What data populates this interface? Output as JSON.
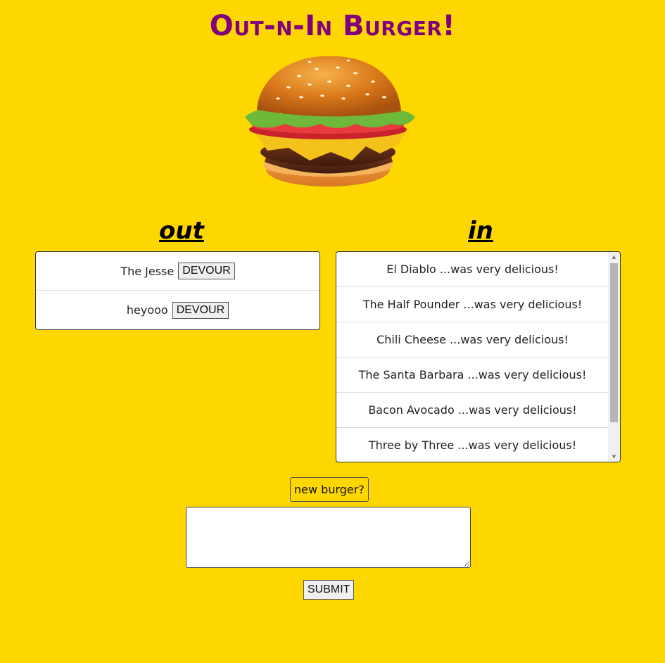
{
  "header": {
    "title": "Out-n-In Burger!"
  },
  "hero": {
    "image": "burger-illustration"
  },
  "out_column": {
    "heading": "out",
    "items": [
      {
        "name": "The Jesse",
        "button_label": "DEVOUR"
      },
      {
        "name": "heyooo",
        "button_label": "DEVOUR"
      }
    ]
  },
  "in_column": {
    "heading": "in",
    "items": [
      {
        "text": "El Diablo ...was very delicious!"
      },
      {
        "text": "The Half Pounder ...was very delicious!"
      },
      {
        "text": "Chili Cheese ...was very delicious!"
      },
      {
        "text": "The Santa Barbara ...was very delicious!"
      },
      {
        "text": "Bacon Avocado ...was very delicious!"
      },
      {
        "text": "Three by Three ...was very delicious!"
      }
    ]
  },
  "form": {
    "new_burger_label": "new burger?",
    "input_value": "",
    "submit_label": "SUBMIT"
  },
  "colors": {
    "background": "#FFD700",
    "title": "#800080"
  }
}
